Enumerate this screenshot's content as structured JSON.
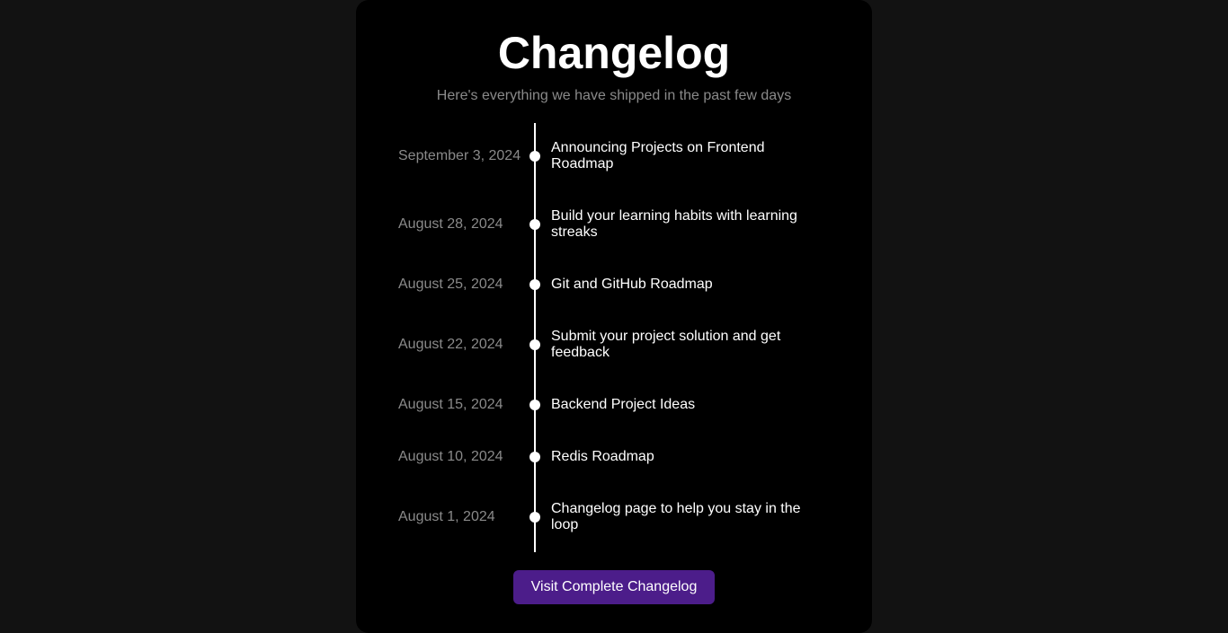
{
  "header": {
    "title": "Changelog",
    "subtitle": "Here's everything we have shipped in the past few days"
  },
  "entries": [
    {
      "date": "September 3, 2024",
      "title": "Announcing Projects on Frontend Roadmap"
    },
    {
      "date": "August 28, 2024",
      "title": "Build your learning habits with learning streaks"
    },
    {
      "date": "August 25, 2024",
      "title": "Git and GitHub Roadmap"
    },
    {
      "date": "August 22, 2024",
      "title": "Submit your project solution and get feedback"
    },
    {
      "date": "August 15, 2024",
      "title": "Backend Project Ideas"
    },
    {
      "date": "August 10, 2024",
      "title": "Redis Roadmap"
    },
    {
      "date": "August 1, 2024",
      "title": "Changelog page to help you stay in the loop"
    }
  ],
  "footer": {
    "button_label": "Visit Complete Changelog"
  },
  "colors": {
    "page_background": "#121212",
    "card_background": "#000000",
    "muted_text": "#8a8a8a",
    "accent_button": "#4c1d8a"
  }
}
